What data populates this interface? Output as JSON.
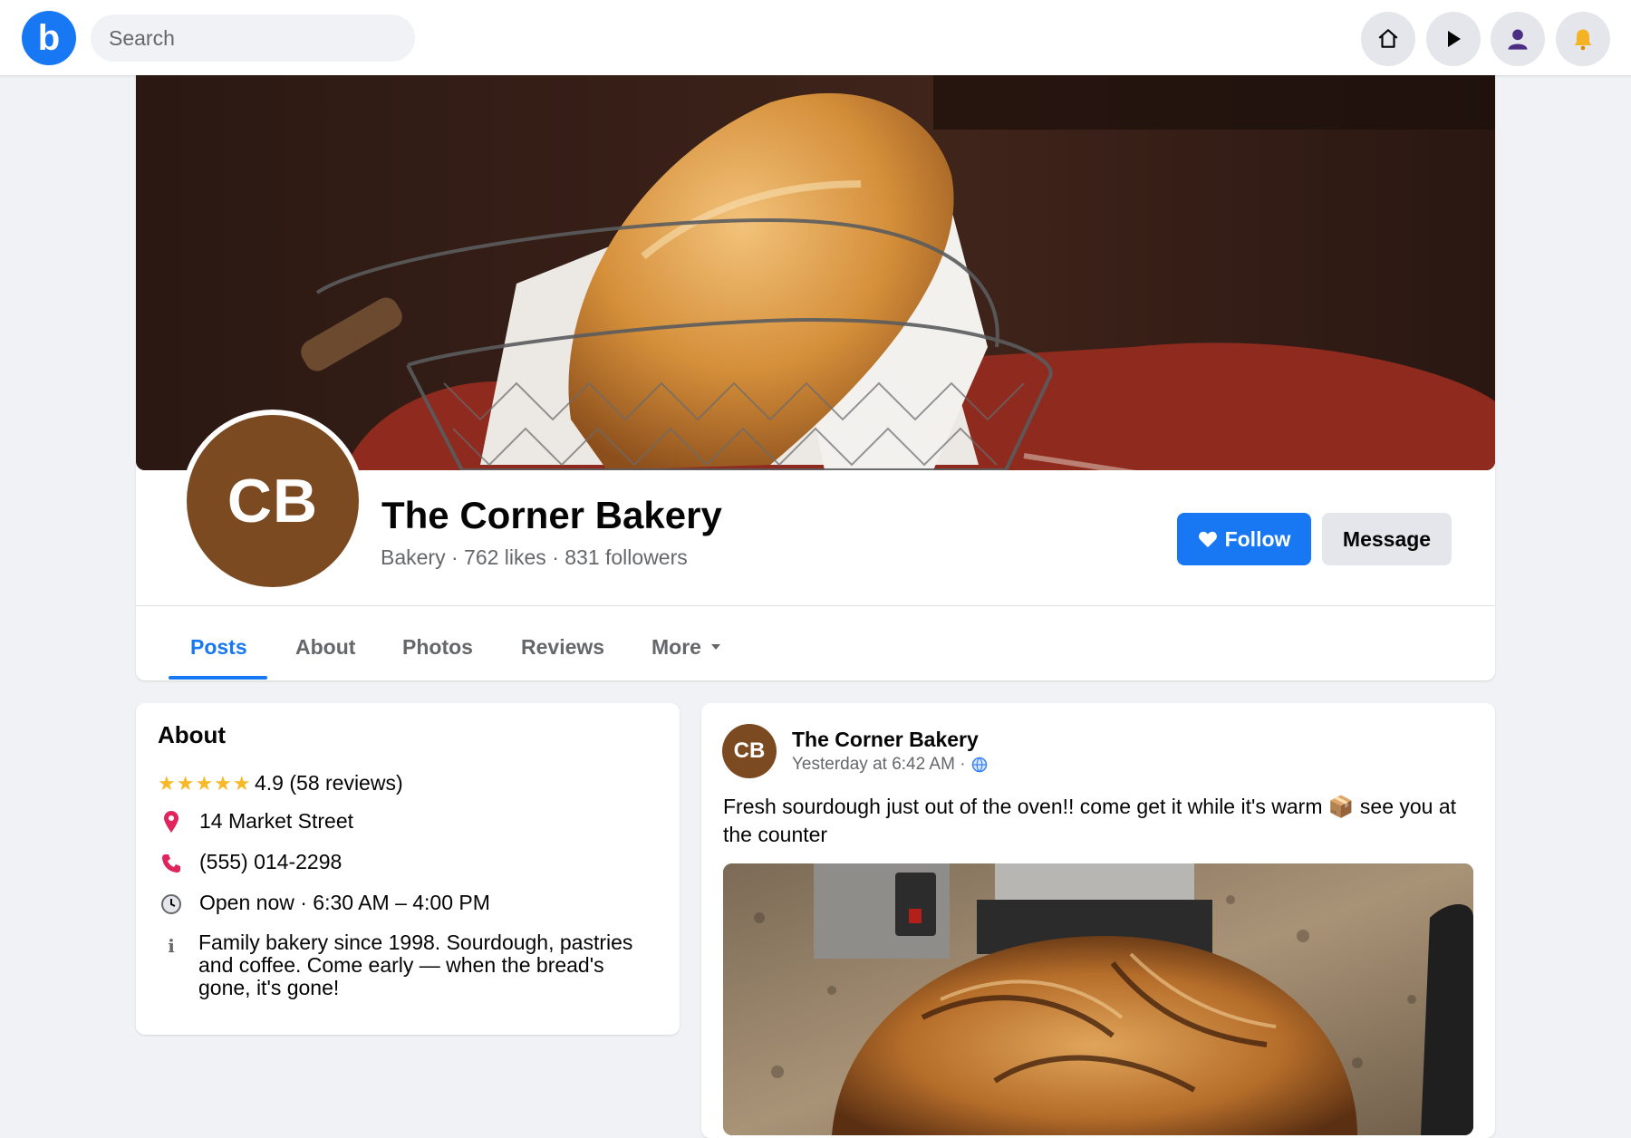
{
  "topbar": {
    "logo_letter": "b",
    "search_placeholder": "Search",
    "nav_icons": [
      "home-icon",
      "play-icon",
      "profile-icon",
      "bell-icon"
    ]
  },
  "colors": {
    "brand": "#1877f2",
    "avatar_brown": "#7b4a21",
    "muted_text": "#65676b",
    "star": "#f7b928"
  },
  "page": {
    "initials": "CB",
    "name": "The Corner Bakery",
    "subtitle": "Bakery · 762 likes · 831 followers",
    "follow_label": "Follow",
    "message_label": "Message"
  },
  "tabs": [
    {
      "label": "Posts",
      "active": true
    },
    {
      "label": "About",
      "active": false
    },
    {
      "label": "Photos",
      "active": false
    },
    {
      "label": "Reviews",
      "active": false
    },
    {
      "label": "More",
      "active": false
    }
  ],
  "about": {
    "heading": "About",
    "stars": "★★★★★",
    "rating": 4.9,
    "rating_text": "4.9 (58 reviews)",
    "address": "14 Market Street",
    "phone": "(555) 014-2298",
    "hours": "Open now · 6:30 AM – 4:00 PM",
    "description": "Family bakery since 1998. Sourdough, pastries and coffee. Come early — when the bread's gone, it's gone!"
  },
  "post": {
    "author_initials": "CB",
    "author": "The Corner Bakery",
    "timestamp": "Yesterday at 6:42 AM ·",
    "text": "Fresh sourdough just out of the oven!! come get it while it's warm 📦 see you at the counter"
  }
}
